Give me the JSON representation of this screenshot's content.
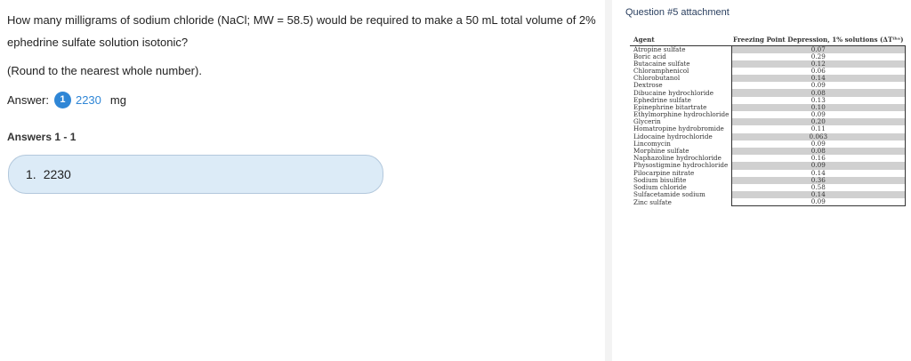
{
  "question": {
    "line1": "How many milligrams of sodium chloride (NaCl; MW = 58.5) would be required to make a 50 mL total volume of 2%",
    "line2": "ephedrine sulfate solution isotonic?",
    "line3": "(Round to the nearest whole number)."
  },
  "answer": {
    "label": "Answer:",
    "badge": "1",
    "value": "2230",
    "unit": "mg"
  },
  "answers_list": {
    "heading": "Answers 1 - 1",
    "items": [
      {
        "number": "1.",
        "value": "2230"
      }
    ]
  },
  "attachment": {
    "title": "Question #5 attachment",
    "columns": [
      "Agent",
      "Freezing Point Depression, 1% solutions (ΔTⁱʰᵃ)"
    ],
    "rows": [
      {
        "agent": "Atropine sulfate",
        "value": "0.07"
      },
      {
        "agent": "Boric acid",
        "value": "0.29"
      },
      {
        "agent": "Butacaine sulfate",
        "value": "0.12"
      },
      {
        "agent": "Chloramphenicol",
        "value": "0.06"
      },
      {
        "agent": "Chlorobutanol",
        "value": "0.14"
      },
      {
        "agent": "Dextrose",
        "value": "0.09"
      },
      {
        "agent": "Dibucaine hydrochloride",
        "value": "0.08"
      },
      {
        "agent": "Ephedrine sulfate",
        "value": "0.13"
      },
      {
        "agent": "Epinephrine bitartrate",
        "value": "0.10"
      },
      {
        "agent": "Ethylmorphine hydrochloride",
        "value": "0.09"
      },
      {
        "agent": "Glycerin",
        "value": "0.20"
      },
      {
        "agent": "Homatropine hydrobromide",
        "value": "0.11"
      },
      {
        "agent": "Lidocaine hydrochloride",
        "value": "0.063"
      },
      {
        "agent": "Lincomycin",
        "value": "0.09"
      },
      {
        "agent": "Morphine sulfate",
        "value": "0.08"
      },
      {
        "agent": "Naphazoline hydrochloride",
        "value": "0.16"
      },
      {
        "agent": "Physostigmine hydrochloride",
        "value": "0.09"
      },
      {
        "agent": "Pilocarpine nitrate",
        "value": "0.14"
      },
      {
        "agent": "Sodium bisulfite",
        "value": "0.36"
      },
      {
        "agent": "Sodium chloride",
        "value": "0.58"
      },
      {
        "agent": "Sulfacetamide sodium",
        "value": "0.14"
      },
      {
        "agent": "Zinc sulfate",
        "value": "0.09"
      }
    ]
  }
}
